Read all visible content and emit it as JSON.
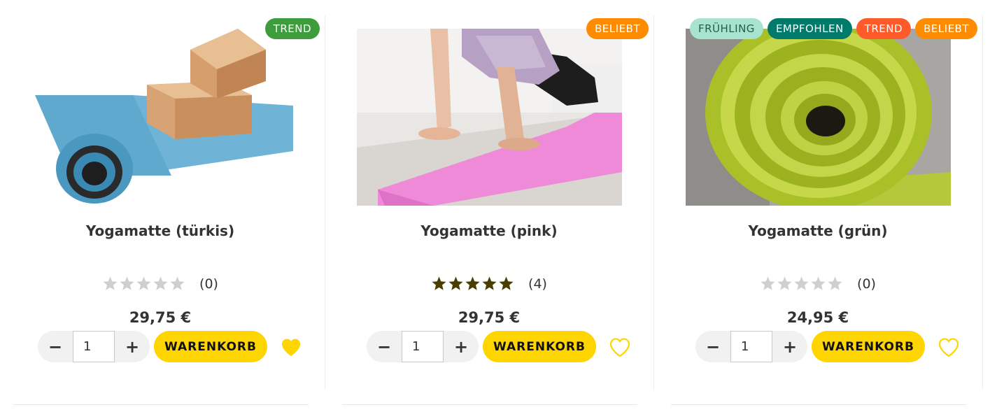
{
  "colors": {
    "accent_yellow": "#ffd500",
    "star_filled": "#4a3d00",
    "star_empty": "#cfcfcf"
  },
  "products": [
    {
      "name": "Yogamatte (türkis)",
      "badges": [
        {
          "label": "TREND",
          "color": "#3d9d3d"
        }
      ],
      "rating": 0,
      "review_count": "(0)",
      "price": "29,75 €",
      "quantity": "1",
      "cart_label": "WARENKORB",
      "wishlisted": true
    },
    {
      "name": "Yogamatte (pink)",
      "badges": [
        {
          "label": "BELIEBT",
          "color": "#ff8c00"
        }
      ],
      "rating": 5,
      "review_count": "(4)",
      "price": "29,75 €",
      "quantity": "1",
      "cart_label": "WARENKORB",
      "wishlisted": false
    },
    {
      "name": "Yogamatte (grün)",
      "badges": [
        {
          "label": "FRÜHLING",
          "color": "#a8e3d0"
        },
        {
          "label": "EMPFOHLEN",
          "color": "#007a6a"
        },
        {
          "label": "TREND",
          "color": "#ff5a29"
        },
        {
          "label": "BELIEBT",
          "color": "#ff8c00"
        }
      ],
      "rating": 0,
      "review_count": "(0)",
      "price": "24,95 €",
      "quantity": "1",
      "cart_label": "WARENKORB",
      "wishlisted": false
    }
  ]
}
